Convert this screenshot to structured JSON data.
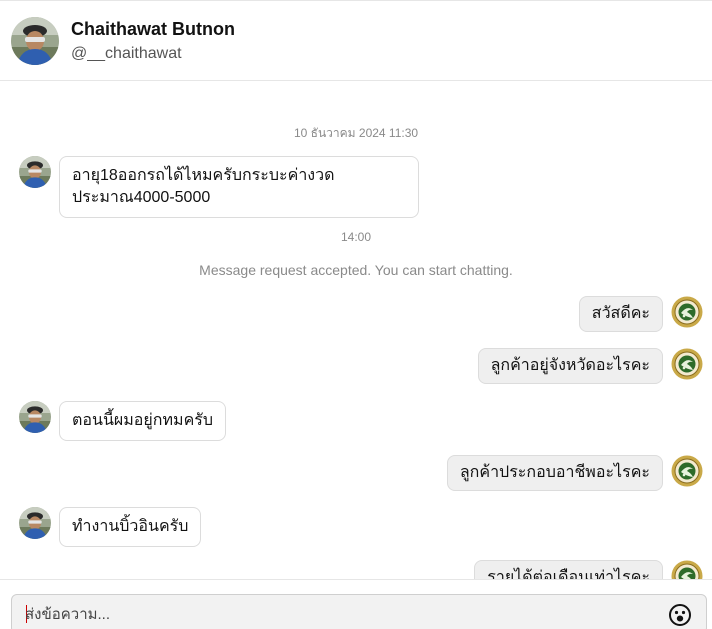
{
  "header": {
    "name": "Chaithawat Butnon",
    "handle": "@__chaithawat"
  },
  "messages": {
    "timestamp_1": "10 ธันวาคม 2024 11:30",
    "msg_1": "อายุ18ออกรถได้ไหมครับกระบะค่างวด\nประมาณ4000-5000",
    "timestamp_2": "14:00",
    "system_note": "Message request accepted. You can start chatting.",
    "msg_2": "สวัสดีคะ",
    "msg_3": "ลูกค้าอยู่จังหวัดอะไรคะ",
    "msg_4": "ตอนนี้ผมอยู่กทมครับ",
    "msg_5": "ลูกค้าประกอบอาชีพอะไรคะ",
    "msg_6": "ทำงานบิ้วอินครับ",
    "msg_7": "รายได้ต่อเดือนเท่าไรคะ"
  },
  "composer": {
    "placeholder": "ส่งข้อความ..."
  },
  "icons": {
    "emoji": "smiley-icon",
    "seal": "seal-logo"
  },
  "colors": {
    "outgoing_bubble": "#efefef",
    "incoming_bubble": "#ffffff",
    "seal_green": "#2e6b2a",
    "seal_gold": "#c9a948"
  }
}
